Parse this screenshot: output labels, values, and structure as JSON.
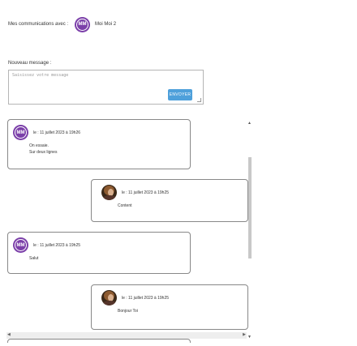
{
  "header": {
    "label": "Mes communications avec :",
    "avatar_initials": "MM",
    "contact_name": "Moi Moi 2"
  },
  "composer": {
    "label": "Nouveau message :",
    "placeholder": "Saisissez votre message",
    "send_label": "ENVOYER"
  },
  "messages": [
    {
      "side": "left",
      "avatar": "MM",
      "date": "le : 11 juillet 2023 à 19h26",
      "lines": [
        "On essaie.",
        "Sur deux lignes"
      ]
    },
    {
      "side": "right",
      "avatar": "photo",
      "date": "le : 11 juillet 2023 à 19h25",
      "lines": [
        "Content"
      ]
    },
    {
      "side": "left",
      "avatar": "MM",
      "date": "le : 11 juillet 2023 à 19h25",
      "lines": [
        "Salut"
      ]
    },
    {
      "side": "right",
      "avatar": "photo",
      "date": "le : 11 juillet 2023 à 19h25",
      "lines": [
        "Bonjour Toi"
      ]
    },
    {
      "side": "left",
      "avatar": "photo",
      "date": "",
      "lines": []
    }
  ],
  "scroll": {
    "up": "▲",
    "down": "▼",
    "left": "◀",
    "right": "▶"
  }
}
